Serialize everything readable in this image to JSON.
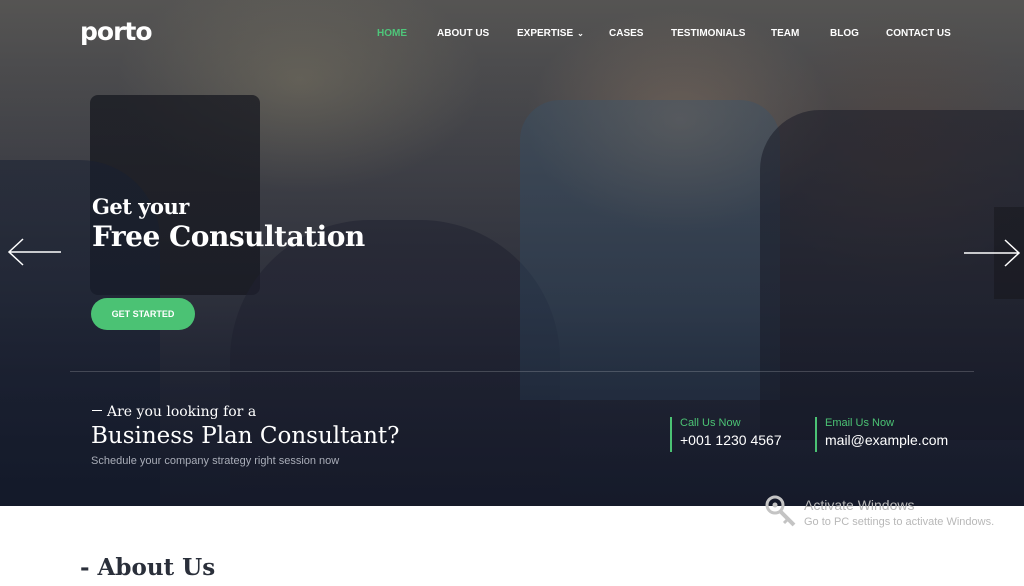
{
  "brand": {
    "logo_text": "porto"
  },
  "nav": {
    "items": [
      {
        "label": "HOME",
        "active": true
      },
      {
        "label": "ABOUT US"
      },
      {
        "label": "EXPERTISE",
        "has_dropdown": true
      },
      {
        "label": "CASES"
      },
      {
        "label": "TESTIMONIALS"
      },
      {
        "label": "TEAM"
      },
      {
        "label": "BLOG"
      },
      {
        "label": "CONTACT US"
      }
    ]
  },
  "hero": {
    "heading_small": "Get your",
    "heading_big": "Free Consultation",
    "cta_label": "GET STARTED",
    "lead_small": "Are you looking for a",
    "lead_big": "Business Plan Consultant?",
    "lead_sub": "Schedule your company strategy right session now"
  },
  "contact": {
    "call_label": "Call Us Now",
    "call_value": "+001 1230 4567",
    "email_label": "Email Us Now",
    "email_value": "mail@example.com"
  },
  "watermark": {
    "title": "Activate Windows",
    "subtitle": "Go to PC settings to activate Windows."
  },
  "about": {
    "heading": "- About Us"
  },
  "colors": {
    "accent": "#4bc274",
    "dark": "#2a2f3a"
  },
  "icons": [
    "arrow-left-icon",
    "arrow-right-icon",
    "chevron-down-icon",
    "key-icon"
  ]
}
